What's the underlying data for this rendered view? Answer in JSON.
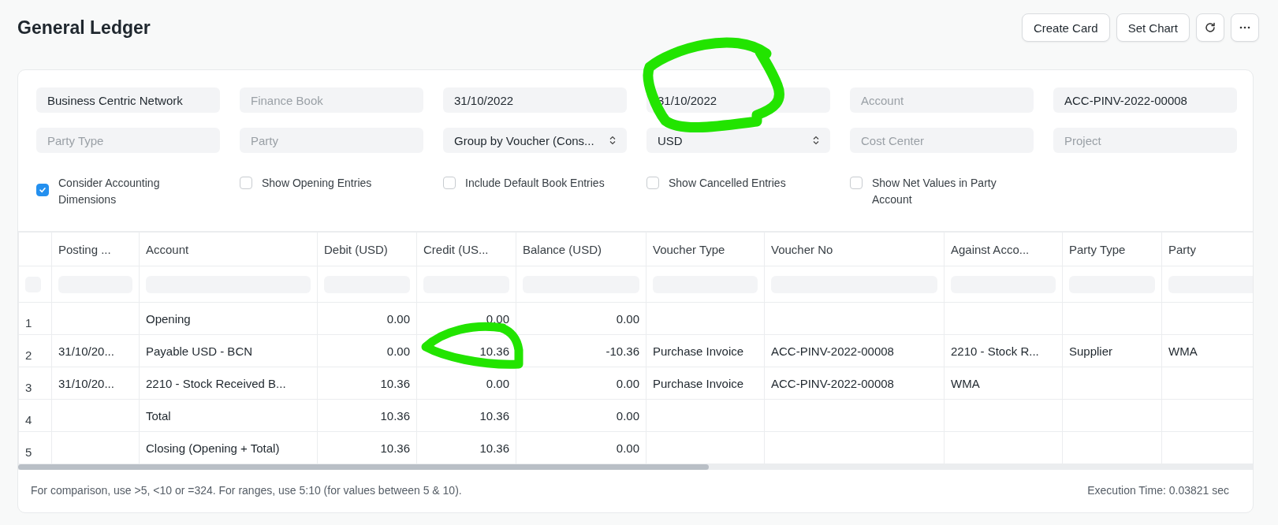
{
  "page": {
    "title": "General Ledger"
  },
  "actions": [
    {
      "kind": "text",
      "label": "Create Card"
    },
    {
      "kind": "text",
      "label": "Set Chart"
    },
    {
      "kind": "refresh"
    },
    {
      "kind": "more"
    }
  ],
  "filters": [
    {
      "kind": "text",
      "value": "Business Centric Network"
    },
    {
      "kind": "text",
      "placeholder": "Finance Book"
    },
    {
      "kind": "text",
      "value": "31/10/2022"
    },
    {
      "kind": "text",
      "value": "31/10/2022"
    },
    {
      "kind": "text",
      "placeholder": "Account"
    },
    {
      "kind": "text",
      "value": "ACC-PINV-2022-00008"
    },
    {
      "kind": "text",
      "placeholder": "Party Type"
    },
    {
      "kind": "text",
      "placeholder": "Party"
    },
    {
      "kind": "select",
      "value": "Group by Voucher (Cons..."
    },
    {
      "kind": "select",
      "value": "USD"
    },
    {
      "kind": "text",
      "placeholder": "Cost Center"
    },
    {
      "kind": "text",
      "placeholder": "Project"
    }
  ],
  "checkboxes": [
    {
      "label": "Consider Accounting Dimensions",
      "checked": true
    },
    {
      "label": "Show Opening Entries",
      "checked": false
    },
    {
      "label": "Include Default Book Entries",
      "checked": false
    },
    {
      "label": "Show Cancelled Entries",
      "checked": false
    },
    {
      "label": "Show Net Values in Party Account",
      "checked": false
    }
  ],
  "table": {
    "columns": [
      {
        "label": "Posting ...",
        "numeric": false
      },
      {
        "label": "Account",
        "numeric": false
      },
      {
        "label": "Debit (USD)",
        "numeric": true
      },
      {
        "label": "Credit (US...",
        "numeric": true
      },
      {
        "label": "Balance (USD)",
        "numeric": true
      },
      {
        "label": "Voucher Type",
        "numeric": false
      },
      {
        "label": "Voucher No",
        "numeric": false
      },
      {
        "label": "Against Acco...",
        "numeric": false
      },
      {
        "label": "Party Type",
        "numeric": false
      },
      {
        "label": "Party",
        "numeric": false
      }
    ],
    "rows": [
      {
        "index": "1",
        "cells": [
          "",
          "Opening",
          "0.00",
          "0.00",
          "0.00",
          "",
          "",
          "",
          "",
          ""
        ]
      },
      {
        "index": "2",
        "cells": [
          "31/10/20...",
          "Payable USD - BCN",
          "0.00",
          "10.36",
          "-10.36",
          "Purchase Invoice",
          "ACC-PINV-2022-00008",
          "2210 - Stock R...",
          "Supplier",
          "WMA"
        ]
      },
      {
        "index": "3",
        "cells": [
          "31/10/20...",
          "2210 - Stock Received B...",
          "10.36",
          "0.00",
          "0.00",
          "Purchase Invoice",
          "ACC-PINV-2022-00008",
          "WMA",
          "",
          ""
        ]
      },
      {
        "index": "4",
        "cells": [
          "",
          "Total",
          "10.36",
          "10.36",
          "0.00",
          "",
          "",
          "",
          "",
          ""
        ]
      },
      {
        "index": "5",
        "cells": [
          "",
          "Closing (Opening + Total)",
          "10.36",
          "10.36",
          "0.00",
          "",
          "",
          "",
          "",
          ""
        ]
      }
    ]
  },
  "footer": {
    "hint": "For comparison, use >5, <10 or =324. For ranges, use 5:10 (for values between 5 & 10).",
    "execution_time": "Execution Time: 0.03821 sec"
  }
}
